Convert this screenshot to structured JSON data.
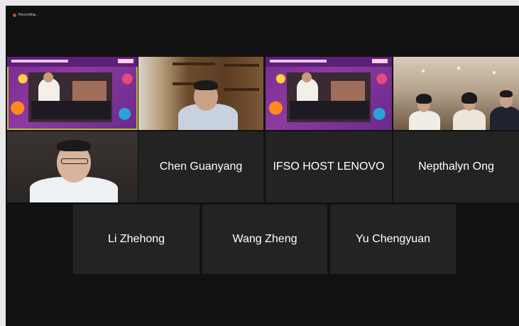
{
  "recording": {
    "label": "Recording..."
  },
  "participants": {
    "row1": [
      {
        "name": "",
        "video": "presentation-slide",
        "active": true
      },
      {
        "name": "",
        "video": "man-in-study"
      },
      {
        "name": "",
        "video": "presentation-slide"
      },
      {
        "name": "",
        "video": "group-of-three"
      }
    ],
    "row2": [
      {
        "name": "",
        "video": "man-with-glasses"
      },
      {
        "name": "Chen Guanyang",
        "video": "off"
      },
      {
        "name": "IFSO HOST LENOVO",
        "video": "off"
      },
      {
        "name": "Nepthalyn Ong",
        "video": "off"
      }
    ],
    "row3": [
      {
        "name": "Li Zhehong",
        "video": "off"
      },
      {
        "name": "Wang Zheng",
        "video": "off"
      },
      {
        "name": "Yu Chengyuan",
        "video": "off"
      }
    ]
  },
  "colors": {
    "background": "#111111",
    "tile": "#232323",
    "active_speaker_border": "#c8bf2f",
    "recording_dot": "#e23b3b"
  }
}
